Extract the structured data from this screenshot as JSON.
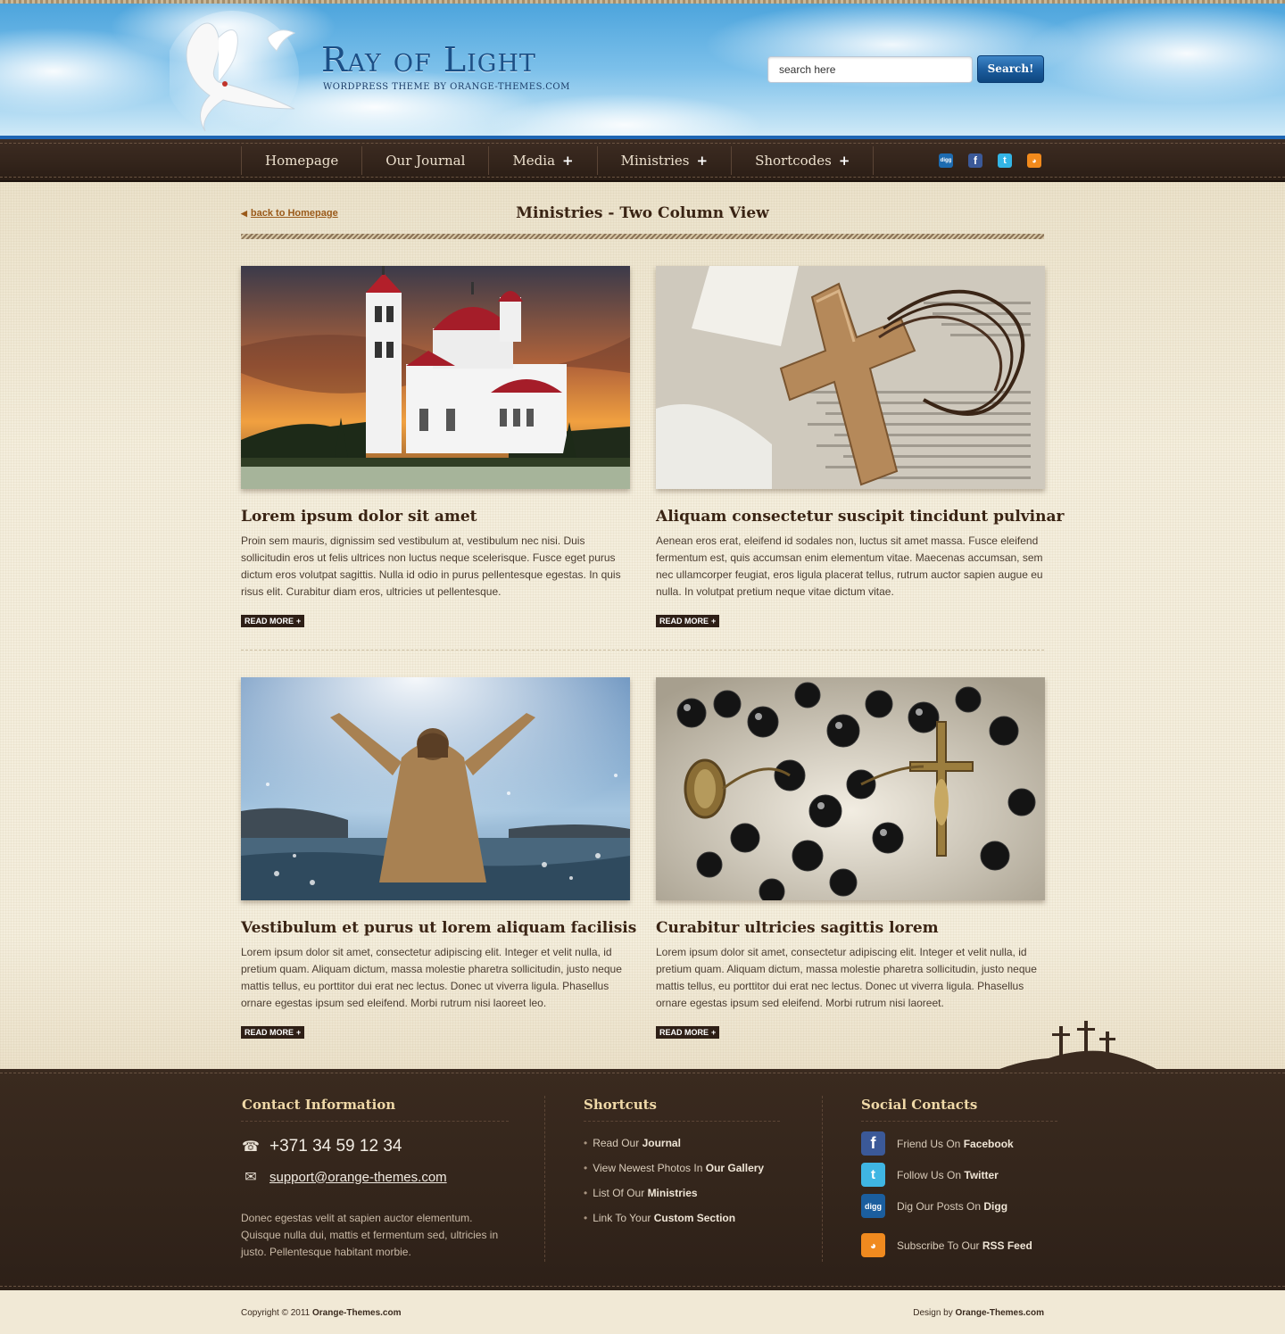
{
  "header": {
    "logo_title": "Ray of Light",
    "logo_subtitle": "WORDPRESS THEME BY ORANGE-THEMES.COM",
    "search": {
      "value": "search here",
      "button_label": "Search!"
    }
  },
  "nav": {
    "items": [
      {
        "label": "Homepage",
        "has_submenu": false
      },
      {
        "label": "Our Journal",
        "has_submenu": false
      },
      {
        "label": "Media",
        "has_submenu": true
      },
      {
        "label": "Ministries",
        "has_submenu": true
      },
      {
        "label": "Shortcodes",
        "has_submenu": true
      }
    ],
    "submenu_marker": "+",
    "social_icons": [
      "digg-icon",
      "facebook-icon",
      "twitter-icon",
      "rss-icon"
    ]
  },
  "page": {
    "back_link": "back to Homepage",
    "title": "Ministries - Two Column View"
  },
  "posts": [
    {
      "title": "Lorem ipsum dolor sit amet",
      "excerpt": "Proin sem mauris, dignissim sed vestibulum at, vestibulum nec nisi. Duis sollicitudin eros ut felis ultrices non luctus neque scelerisque. Fusce eget purus dictum eros volutpat sagittis. Nulla id odio in purus pellentesque egestas. In quis risus elit. Curabitur diam eros, ultricies ut pellentesque.",
      "read_more": "READ MORE",
      "image": "church-at-sunset"
    },
    {
      "title": "Aliquam consectetur suscipit tincidunt pulvinar",
      "excerpt": "Aenean eros erat, eleifend id sodales non, luctus sit amet massa. Fusce eleifend fermentum est, quis accumsan enim elementum vitae. Maecenas accumsan, sem nec ullamcorper feugiat, eros ligula placerat tellus, rutrum auctor sapien augue eu nulla. In volutpat pretium neque vitae dictum vitae.",
      "read_more": "READ MORE",
      "image": "wooden-cross-on-bible"
    },
    {
      "title": "Vestibulum et purus ut lorem aliquam facilisis",
      "excerpt": "Lorem ipsum dolor sit amet, consectetur adipiscing elit. Integer et velit nulla, id pretium quam. Aliquam dictum, massa molestie pharetra sollicitudin, justo neque mattis tellus, eu porttitor dui erat nec lectus. Donec ut viverra ligula. Phasellus ornare egestas ipsum sed eleifend. Morbi rutrum nisi laoreet leo.",
      "read_more": "READ MORE",
      "image": "figure-raising-arms-in-water"
    },
    {
      "title": "Curabitur ultricies sagittis lorem",
      "excerpt": "Lorem ipsum dolor sit amet, consectetur adipiscing elit. Integer et velit nulla, id pretium quam. Aliquam dictum, massa molestie pharetra sollicitudin, justo neque mattis tellus, eu porttitor dui erat nec lectus. Donec ut viverra ligula. Phasellus ornare egestas ipsum sed eleifend. Morbi rutrum nisi laoreet.",
      "read_more": "READ MORE",
      "image": "rosary-beads-and-crucifix"
    }
  ],
  "footer": {
    "contact": {
      "heading": "Contact Information",
      "phone": "+371 34 59 12 34",
      "email": "support@orange-themes.com",
      "description": "Donec egestas velit at sapien auctor elementum. Quisque nulla dui, mattis et fermentum sed, ultricies in justo. Pellentesque habitant morbie."
    },
    "shortcuts": {
      "heading": "Shortcuts",
      "items": [
        {
          "text": "Read Our",
          "bold": "Journal"
        },
        {
          "text": "View Newest Photos In",
          "bold": "Our Gallery"
        },
        {
          "text": "List Of Our",
          "bold": "Ministries"
        },
        {
          "text": "Link To Your",
          "bold": "Custom Section"
        }
      ]
    },
    "social": {
      "heading": "Social Contacts",
      "items": [
        {
          "icon": "facebook-icon",
          "text": "Friend Us On",
          "bold": "Facebook"
        },
        {
          "icon": "twitter-icon",
          "text": "Follow Us On",
          "bold": "Twitter"
        },
        {
          "icon": "digg-icon",
          "text": "Dig Our Posts On",
          "bold": "Digg"
        },
        {
          "icon": "rss-icon",
          "text": "Subscribe To Our",
          "bold": "RSS Feed"
        }
      ]
    }
  },
  "bottom": {
    "copyright_prefix": "Copyright © 2011",
    "copyright_link": "Orange-Themes.com",
    "design_prefix": "Design by",
    "design_link": "Orange-Themes.com"
  },
  "colors": {
    "nav_bg": "#33241b",
    "page_bg": "#f1e9d6",
    "accent_link": "#9a5a1a",
    "heading_footer": "#f0d9a8",
    "search_button": "#1b5b9b"
  }
}
